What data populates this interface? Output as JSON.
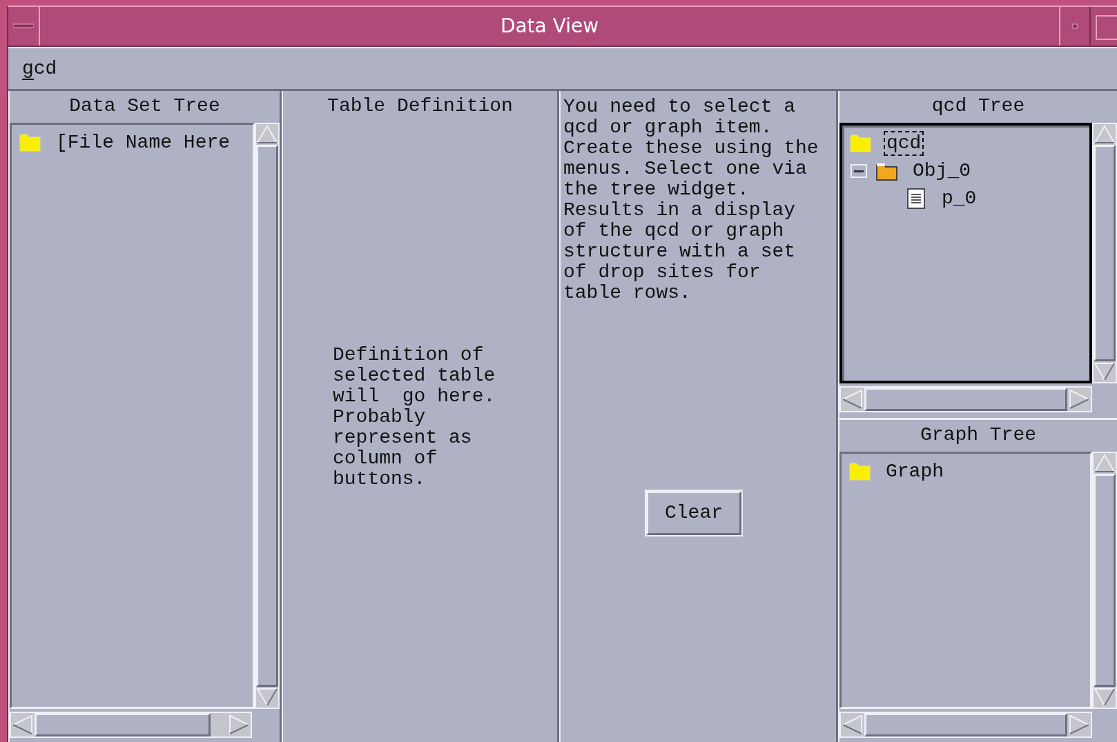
{
  "window": {
    "title": "Data View"
  },
  "menu_bar": [
    {
      "label": "gcd",
      "first_letter_underlined": true
    }
  ],
  "data_set_tree": {
    "title": "Data Set Tree",
    "items": [
      {
        "label": "[File Name Here",
        "kind": "folder"
      }
    ]
  },
  "table_definition": {
    "title": "Table Definition",
    "text": "Definition of\nselected table\nwill  go here.\nProbably\nrepresent as\ncolumn of\nbuttons."
  },
  "instructions": {
    "text": "You need to select a\nqcd or graph item.\nCreate these using the\nmenus. Select one via\nthe tree widget.\nResults in a display\nof the qcd or graph\nstructure with a set\nof drop sites for\ntable rows.",
    "button": "Clear"
  },
  "qcd_tree": {
    "title": "qcd Tree",
    "focused": true,
    "items": [
      {
        "label": "qcd",
        "kind": "folder",
        "selected": true,
        "children": [
          {
            "label": "Obj_0",
            "kind": "open_folder",
            "selected": false,
            "expanded": true,
            "children": [
              {
                "label": "p_0",
                "kind": "document",
                "selected": false
              }
            ]
          }
        ]
      }
    ]
  },
  "graph_tree": {
    "title": "Graph Tree",
    "items": [
      {
        "label": "Graph",
        "kind": "folder"
      }
    ]
  }
}
